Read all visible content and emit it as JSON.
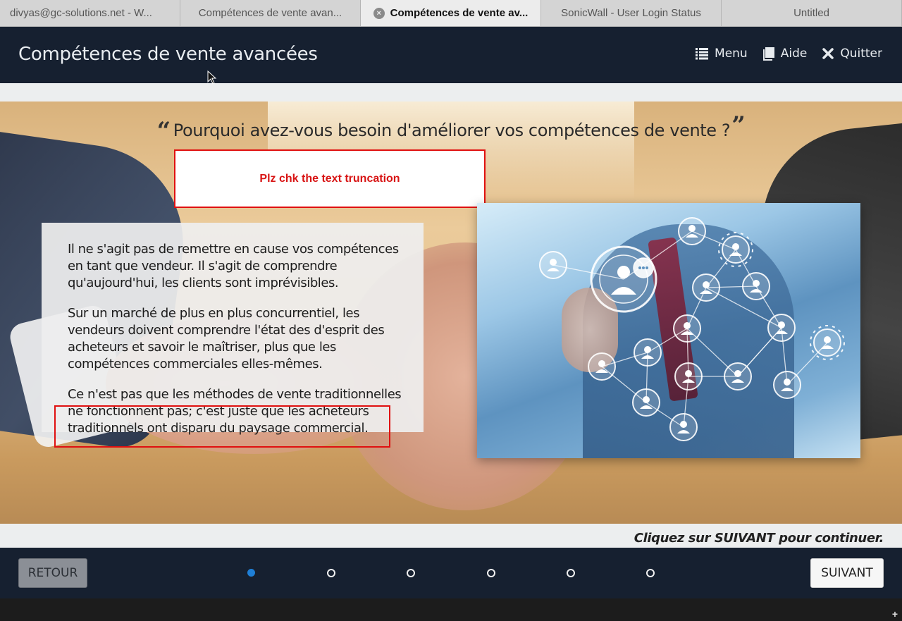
{
  "browser_tabs": [
    {
      "label": "divyas@gc-solutions.net - W...",
      "active": false
    },
    {
      "label": "Compétences de vente avan...",
      "active": false
    },
    {
      "label": "Compétences de vente av...",
      "active": true
    },
    {
      "label": "SonicWall - User Login Status",
      "active": false
    },
    {
      "label": "Untitled",
      "active": false
    }
  ],
  "header": {
    "title": "Compétences de vente avancées",
    "nav": [
      {
        "label": "Menu",
        "icon": "list-icon"
      },
      {
        "label": "Aide",
        "icon": "book-icon"
      },
      {
        "label": "Quitter",
        "icon": "close-icon"
      }
    ]
  },
  "slide": {
    "heading": "Pourquoi avez-vous besoin d'améliorer vos compétences de vente ?",
    "quote_open": "“",
    "quote_close": "”",
    "annotation_note": "Plz chk the text truncation",
    "paragraphs": [
      "Il ne s'agit pas de remettre en cause vos compétences en tant que vendeur. Il s'agit de comprendre qu'aujourd'hui, les clients sont imprévisibles.",
      "Sur un marché de plus en plus concurrentiel, les vendeurs doivent comprendre l'état des d'esprit des acheteurs et savoir le maîtriser, plus que les compétences commerciales elles-mêmes.",
      "Ce n'est pas que les méthodes de vente traditionnelles ne fonctionnent pas; c'est juste que les acheteurs traditionnels ont disparu du paysage commercial."
    ],
    "annotation_color": "#e01010"
  },
  "hint": "Cliquez sur SUIVANT pour continuer.",
  "footer": {
    "back_label": "RETOUR",
    "next_label": "SUIVANT",
    "pages_total": 6,
    "current_page": 1,
    "accent": "#1f7fd6"
  },
  "colors": {
    "header_bg": "#162030",
    "strip_bg": "#eceeef"
  }
}
